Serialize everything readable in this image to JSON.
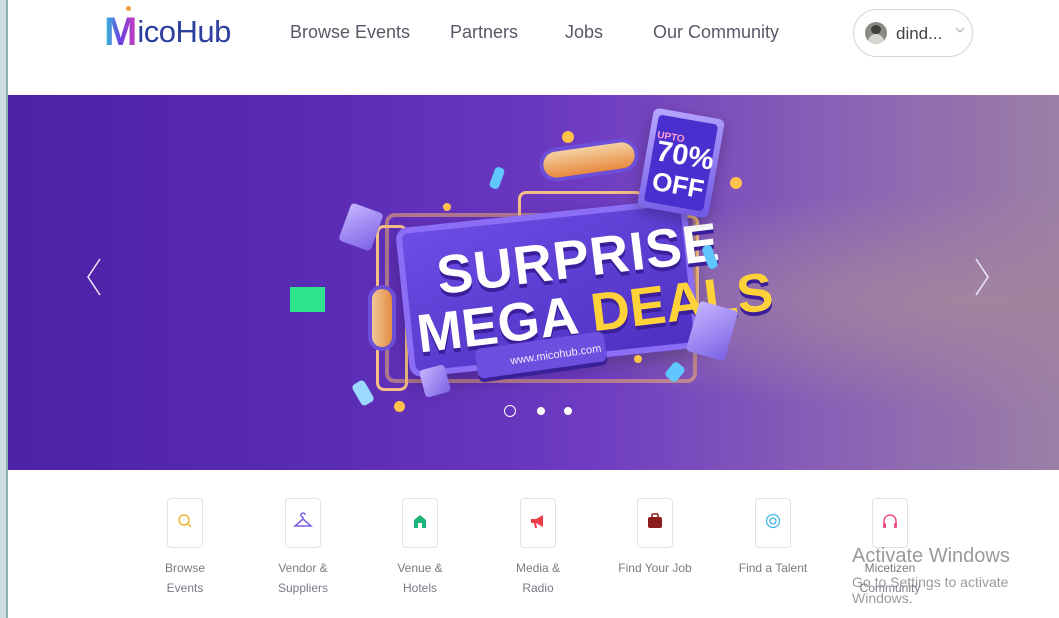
{
  "header": {
    "logo_m": "M",
    "logo_rest": "icoHub",
    "nav": [
      {
        "label": "Browse Events"
      },
      {
        "label": "Partners"
      },
      {
        "label": "Jobs"
      },
      {
        "label": "Our Community"
      }
    ],
    "user": {
      "name": "dind...",
      "chevron": "⌄"
    }
  },
  "banner": {
    "prev_arrow": "‹",
    "next_arrow": "›",
    "headline_line1": "SURPRISE",
    "headline_line2_a": "MEGA ",
    "headline_line2_b": "DEALS",
    "badge_upto": "UPTO",
    "badge_pct": "70%",
    "badge_off": "OFF",
    "url": "www.micohub.com",
    "slide_count": 3,
    "active_slide": 1
  },
  "categories": [
    {
      "label_1": "Browse",
      "label_2": "Events",
      "icon": "search-icon",
      "color": "#f2b632"
    },
    {
      "label_1": "Vendor &",
      "label_2": "Suppliers",
      "icon": "hanger-icon",
      "color": "#7b5fe6"
    },
    {
      "label_1": "Venue &",
      "label_2": "Hotels",
      "icon": "house-icon",
      "color": "#1db57a"
    },
    {
      "label_1": "Media &",
      "label_2": "Radio",
      "icon": "megaphone-icon",
      "color": "#ee3b4a"
    },
    {
      "label_1": "Find Your Job",
      "label_2": "",
      "icon": "briefcase-icon",
      "color": "#8c1d1d"
    },
    {
      "label_1": "Find a Talent",
      "label_2": "",
      "icon": "target-icon",
      "color": "#3fb6e8"
    },
    {
      "label_1": "Micetizen",
      "label_2": "Community",
      "icon": "headphones-icon",
      "color": "#ef4d8a"
    }
  ],
  "watermark": {
    "title": "Activate Windows",
    "subtitle": "Go to Settings to activate Windows."
  }
}
